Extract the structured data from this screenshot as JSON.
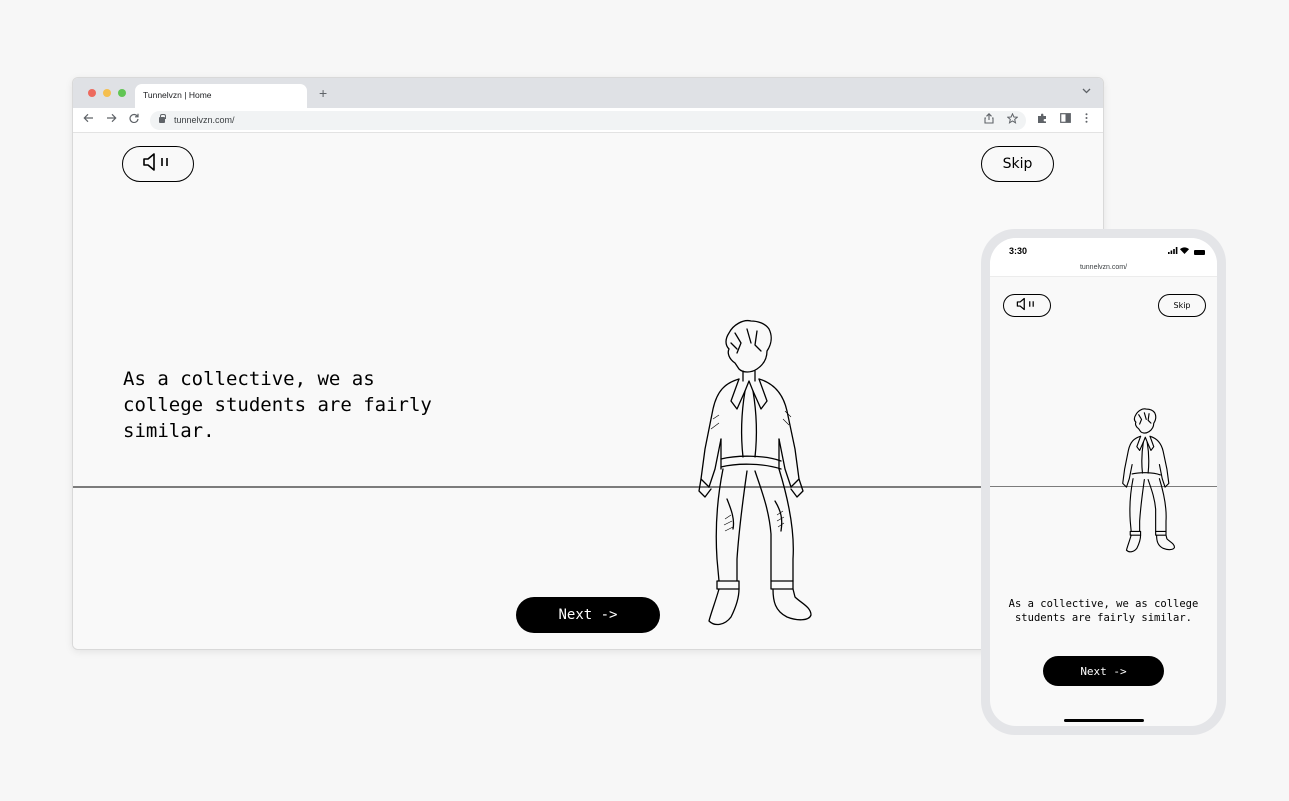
{
  "browser": {
    "tab_title": "Tunnelvzn | Home",
    "new_tab": "+",
    "tab_menu": "⌄",
    "url": "tunnelvzn.com/"
  },
  "page": {
    "skip_label": "Skip",
    "intro_text": "As a collective, we as college students are fairly similar.",
    "next_label": "Next ->"
  },
  "phone": {
    "time": "3:30",
    "url": "tunnelvzn.com/",
    "skip_label": "Skip",
    "intro_text": "As a collective, we as college students are fairly similar.",
    "next_label": "Next ->"
  },
  "icons": {
    "sound": "speaker-pause-icon",
    "figure": "sitting-student-sketch"
  },
  "colors": {
    "page_bg": "#f9f9f9",
    "ink": "#000000",
    "horizon": "#7c7c7c",
    "phone_frame": "#e4e5e8"
  }
}
